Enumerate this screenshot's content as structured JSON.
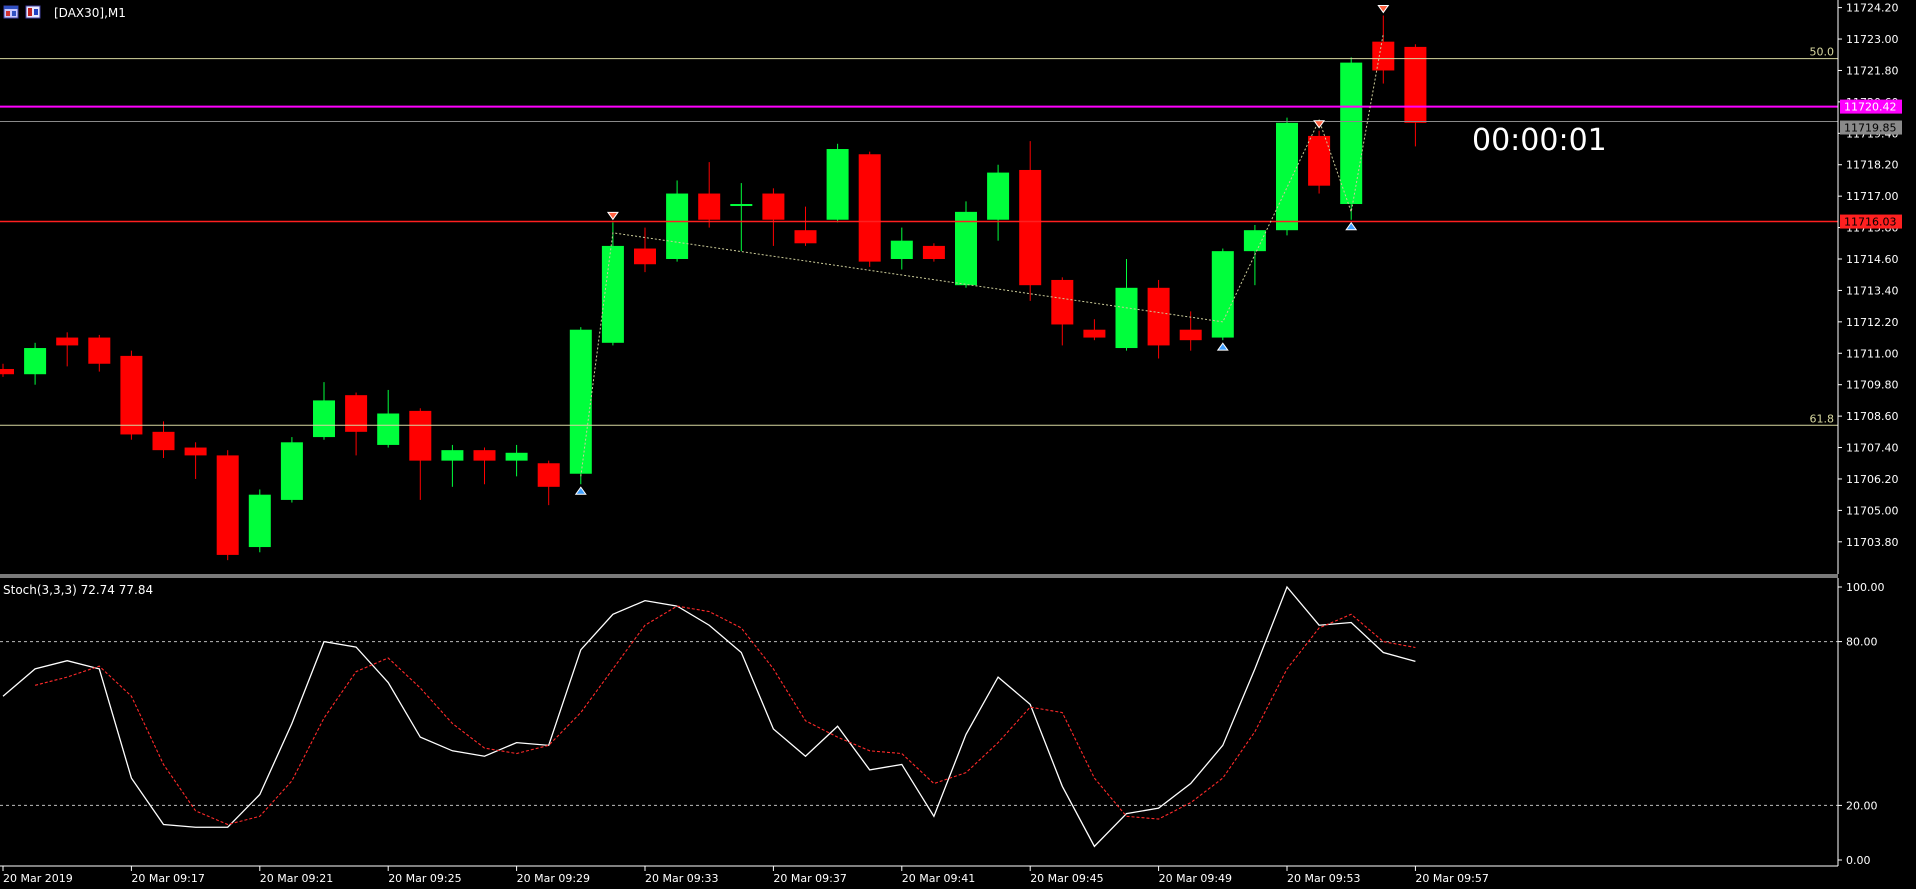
{
  "window": {
    "title": "[DAX30],M1",
    "icon": "chart-window-icon"
  },
  "timer": "00:00:01",
  "colors": {
    "background": "#000000",
    "bull": "#00ff3c",
    "bear": "#ff0000",
    "wick_bull": "#00ff3c",
    "wick_bear": "#ff0000",
    "axis_text": "#ffffff",
    "fib_line": "#d8d8a0",
    "bid_line": "#ff00ff",
    "ask_line": "#8a8a8a",
    "level_line": "#ff2020",
    "stoch_main": "#ffffff",
    "stoch_signal": "#ff2a2a",
    "separator": "#7a7a7a"
  },
  "chart_data": [
    {
      "type": "candlestick",
      "symbol": "[DAX30],M1",
      "ylim": [
        11702.8,
        11724.3
      ],
      "y_ticks": [
        "11724.20",
        "11723.00",
        "11721.80",
        "11720.60",
        "11719.40",
        "11718.20",
        "11717.00",
        "11715.80",
        "11714.60",
        "11713.40",
        "11712.20",
        "11711.00",
        "11709.80",
        "11708.60",
        "11707.40",
        "11706.20",
        "11705.00",
        "11703.80"
      ],
      "x_ticks": [
        {
          "index": 0,
          "label": "20 Mar 2019"
        },
        {
          "index": 4,
          "label": "20 Mar 09:17"
        },
        {
          "index": 8,
          "label": "20 Mar 09:21"
        },
        {
          "index": 12,
          "label": "20 Mar 09:25"
        },
        {
          "index": 16,
          "label": "20 Mar 09:29"
        },
        {
          "index": 20,
          "label": "20 Mar 09:33"
        },
        {
          "index": 24,
          "label": "20 Mar 09:37"
        },
        {
          "index": 28,
          "label": "20 Mar 09:41"
        },
        {
          "index": 32,
          "label": "20 Mar 09:45"
        },
        {
          "index": 36,
          "label": "20 Mar 09:49"
        },
        {
          "index": 40,
          "label": "20 Mar 09:53"
        },
        {
          "index": 44,
          "label": "20 Mar 09:57"
        }
      ],
      "candles": [
        {
          "o": 11710.4,
          "h": 11710.6,
          "l": 11710.1,
          "c": 11710.2
        },
        {
          "o": 11710.2,
          "h": 11711.4,
          "l": 11709.8,
          "c": 11711.2
        },
        {
          "o": 11711.6,
          "h": 11711.8,
          "l": 11710.5,
          "c": 11711.3
        },
        {
          "o": 11711.6,
          "h": 11711.7,
          "l": 11710.3,
          "c": 11710.6
        },
        {
          "o": 11710.9,
          "h": 11711.1,
          "l": 11707.7,
          "c": 11707.9
        },
        {
          "o": 11708.0,
          "h": 11708.4,
          "l": 11707.0,
          "c": 11707.3
        },
        {
          "o": 11707.4,
          "h": 11707.6,
          "l": 11706.2,
          "c": 11707.1
        },
        {
          "o": 11707.1,
          "h": 11707.3,
          "l": 11703.1,
          "c": 11703.3
        },
        {
          "o": 11703.6,
          "h": 11705.8,
          "l": 11703.4,
          "c": 11705.6
        },
        {
          "o": 11705.4,
          "h": 11707.8,
          "l": 11705.3,
          "c": 11707.6
        },
        {
          "o": 11707.8,
          "h": 11709.9,
          "l": 11707.7,
          "c": 11709.2
        },
        {
          "o": 11709.4,
          "h": 11709.5,
          "l": 11707.1,
          "c": 11708.0
        },
        {
          "o": 11707.5,
          "h": 11709.6,
          "l": 11707.4,
          "c": 11708.7
        },
        {
          "o": 11708.8,
          "h": 11708.9,
          "l": 11705.4,
          "c": 11706.9
        },
        {
          "o": 11706.9,
          "h": 11707.5,
          "l": 11705.9,
          "c": 11707.3
        },
        {
          "o": 11707.3,
          "h": 11707.4,
          "l": 11706.0,
          "c": 11706.9
        },
        {
          "o": 11706.9,
          "h": 11707.5,
          "l": 11706.3,
          "c": 11707.2
        },
        {
          "o": 11706.8,
          "h": 11706.9,
          "l": 11705.2,
          "c": 11705.9
        },
        {
          "o": 11706.4,
          "h": 11712.0,
          "l": 11706.0,
          "c": 11711.9
        },
        {
          "o": 11711.4,
          "h": 11716.0,
          "l": 11711.3,
          "c": 11715.1
        },
        {
          "o": 11715.0,
          "h": 11715.8,
          "l": 11714.1,
          "c": 11714.4
        },
        {
          "o": 11714.6,
          "h": 11717.6,
          "l": 11714.5,
          "c": 11717.1
        },
        {
          "o": 11717.1,
          "h": 11718.3,
          "l": 11715.8,
          "c": 11716.1
        },
        {
          "o": 11716.7,
          "h": 11717.5,
          "l": 11714.9,
          "c": 11716.7
        },
        {
          "o": 11717.1,
          "h": 11717.3,
          "l": 11715.1,
          "c": 11716.1
        },
        {
          "o": 11715.7,
          "h": 11716.6,
          "l": 11715.1,
          "c": 11715.2
        },
        {
          "o": 11716.1,
          "h": 11719.0,
          "l": 11716.0,
          "c": 11718.8
        },
        {
          "o": 11718.6,
          "h": 11718.7,
          "l": 11714.3,
          "c": 11714.5
        },
        {
          "o": 11714.6,
          "h": 11715.8,
          "l": 11714.2,
          "c": 11715.3
        },
        {
          "o": 11715.1,
          "h": 11715.2,
          "l": 11714.5,
          "c": 11714.6
        },
        {
          "o": 11713.6,
          "h": 11716.8,
          "l": 11713.5,
          "c": 11716.4
        },
        {
          "o": 11716.1,
          "h": 11718.2,
          "l": 11715.3,
          "c": 11717.9
        },
        {
          "o": 11718.0,
          "h": 11719.1,
          "l": 11713.0,
          "c": 11713.6
        },
        {
          "o": 11713.8,
          "h": 11713.9,
          "l": 11711.3,
          "c": 11712.1
        },
        {
          "o": 11711.9,
          "h": 11712.3,
          "l": 11711.5,
          "c": 11711.6
        },
        {
          "o": 11711.2,
          "h": 11714.6,
          "l": 11711.1,
          "c": 11713.5
        },
        {
          "o": 11713.5,
          "h": 11713.8,
          "l": 11710.8,
          "c": 11711.3
        },
        {
          "o": 11711.9,
          "h": 11712.6,
          "l": 11711.1,
          "c": 11711.5
        },
        {
          "o": 11711.6,
          "h": 11715.0,
          "l": 11711.5,
          "c": 11714.9
        },
        {
          "o": 11714.9,
          "h": 11715.9,
          "l": 11713.6,
          "c": 11715.7
        },
        {
          "o": 11715.7,
          "h": 11720.0,
          "l": 11715.5,
          "c": 11719.8
        },
        {
          "o": 11719.3,
          "h": 11719.5,
          "l": 11717.1,
          "c": 11717.4
        },
        {
          "o": 11716.7,
          "h": 11722.3,
          "l": 11716.1,
          "c": 11722.1
        },
        {
          "o": 11722.9,
          "h": 11723.9,
          "l": 11721.3,
          "c": 11721.8
        },
        {
          "o": 11722.7,
          "h": 11722.8,
          "l": 11718.9,
          "c": 11719.8
        }
      ],
      "fractals": [
        {
          "index": 19,
          "kind": "up"
        },
        {
          "index": 18,
          "kind": "down"
        },
        {
          "index": 38,
          "kind": "down"
        },
        {
          "index": 41,
          "kind": "up"
        },
        {
          "index": 42,
          "kind": "down"
        },
        {
          "index": 43,
          "kind": "up"
        }
      ],
      "zigzag": [
        {
          "index": 18,
          "price": 11706.3
        },
        {
          "index": 19,
          "price": 11715.6
        },
        {
          "index": 38,
          "price": 11712.2
        },
        {
          "index": 41,
          "price": 11719.9
        },
        {
          "index": 42,
          "price": 11716.4
        },
        {
          "index": 43,
          "price": 11723.2
        }
      ],
      "fib_levels": [
        {
          "label": "50.0",
          "price": 11722.25
        },
        {
          "label": "61.8",
          "price": 11708.25
        }
      ],
      "bid": {
        "label": "11720.42",
        "price": 11720.42
      },
      "ask": {
        "label": "11719.85",
        "price": 11719.85
      },
      "level": {
        "label": "11716.03",
        "price": 11716.03
      }
    },
    {
      "type": "line",
      "title": "Stoch(3,3,3) 72.74 77.84",
      "ylim": [
        0,
        100
      ],
      "y_ticks": [
        "100.00",
        "80.00",
        "20.00",
        "0.00"
      ],
      "levels": [
        80,
        20
      ],
      "series": [
        {
          "name": "main",
          "values": [
            60,
            70,
            73,
            70,
            30,
            13,
            12,
            12,
            24,
            50,
            80,
            78,
            65,
            45,
            40,
            38,
            43,
            42,
            77,
            90,
            95,
            93,
            86,
            76,
            48,
            38,
            49,
            33,
            35,
            16,
            46,
            67,
            57,
            27,
            5,
            17,
            19,
            28,
            42,
            70,
            100,
            86,
            87,
            76,
            72.74
          ]
        },
        {
          "name": "signal",
          "values": [
            null,
            64,
            67,
            71,
            60,
            35,
            18,
            13,
            16,
            29,
            52,
            69,
            74,
            63,
            50,
            41,
            39,
            42,
            54,
            70,
            86,
            93,
            91,
            85,
            70,
            51,
            45,
            40,
            39,
            28,
            32,
            43,
            56,
            54,
            30,
            16,
            15,
            21,
            30,
            47,
            70,
            85,
            90,
            80,
            77.84
          ]
        }
      ]
    }
  ]
}
